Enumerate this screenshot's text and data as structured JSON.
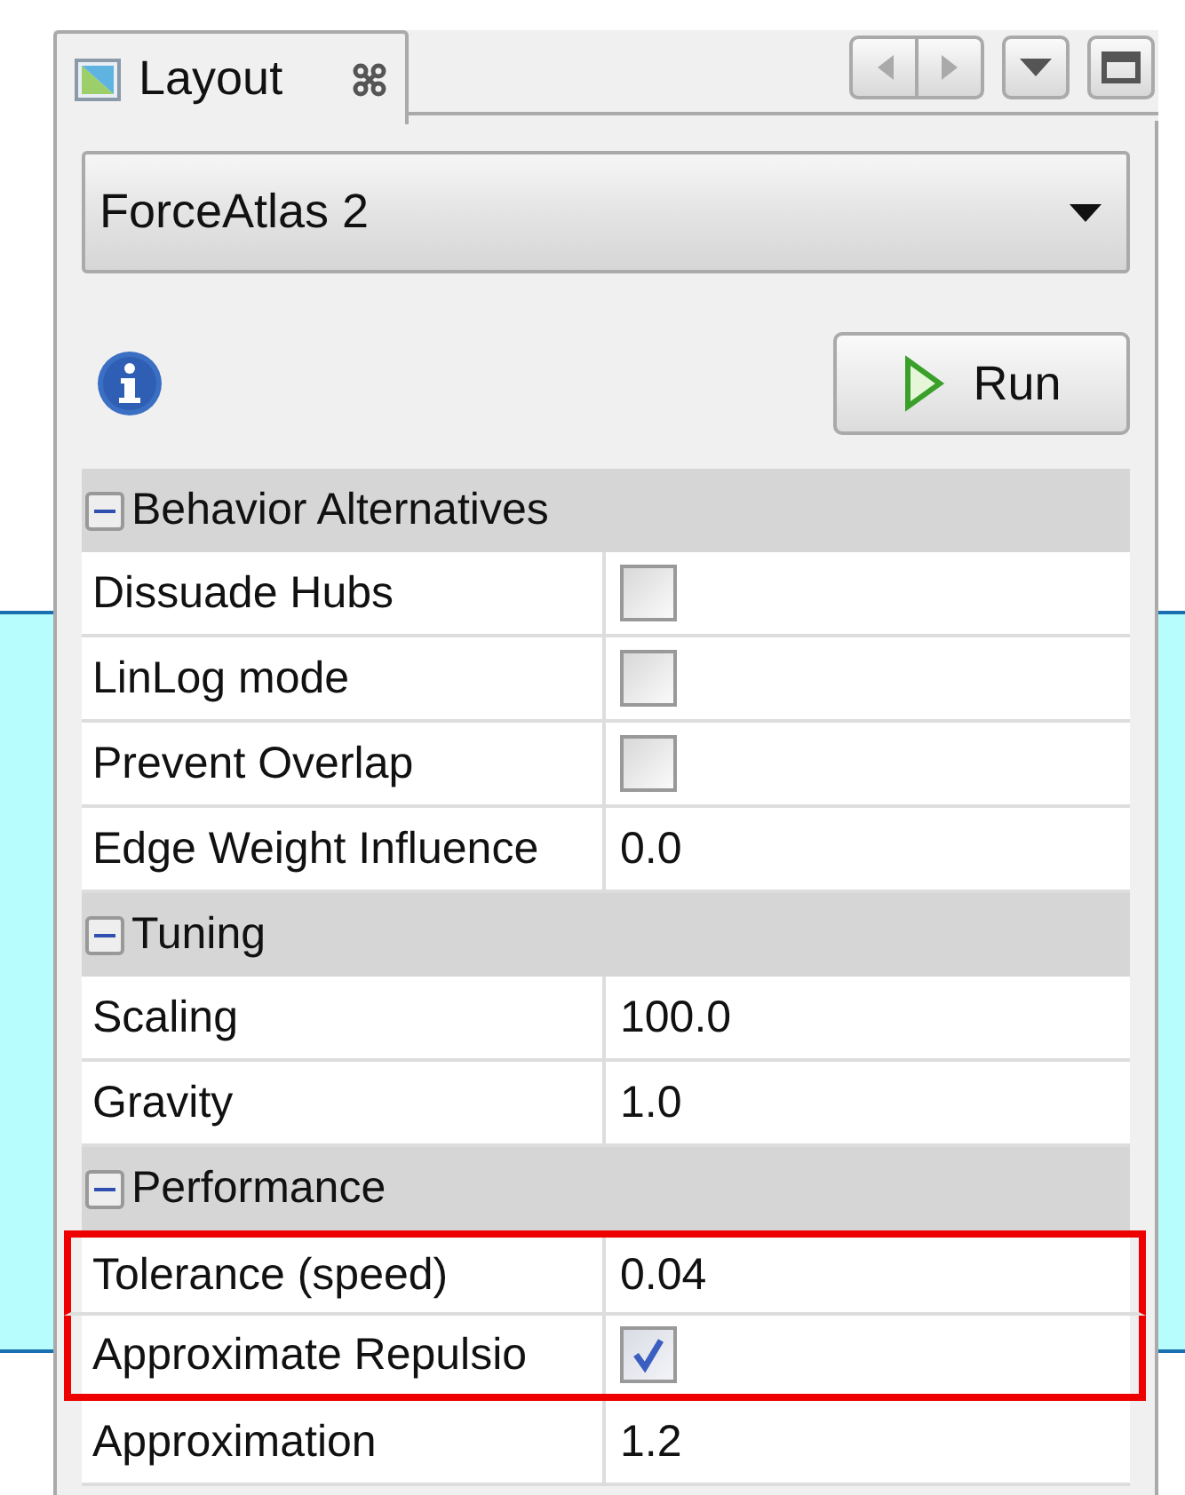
{
  "tab": {
    "label": "Layout",
    "selected": true
  },
  "layout_select": {
    "value": "ForceAtlas 2"
  },
  "run_button": {
    "label": "Run"
  },
  "sections": [
    {
      "title": "Behavior Alternatives",
      "expanded": true,
      "properties": [
        {
          "name": "Dissuade Hubs",
          "kind": "checkbox",
          "checked": false,
          "highlighted": false
        },
        {
          "name": "LinLog mode",
          "kind": "checkbox",
          "checked": false,
          "highlighted": false
        },
        {
          "name": "Prevent Overlap",
          "kind": "checkbox",
          "checked": false,
          "highlighted": false
        },
        {
          "name": "Edge Weight Influence",
          "kind": "value",
          "value": "0.0",
          "highlighted": false
        }
      ]
    },
    {
      "title": "Tuning",
      "expanded": true,
      "properties": [
        {
          "name": "Scaling",
          "kind": "value",
          "value": "100.0",
          "highlighted": false
        },
        {
          "name": "Gravity",
          "kind": "value",
          "value": "1.0",
          "highlighted": false
        }
      ]
    },
    {
      "title": "Performance",
      "expanded": true,
      "properties": [
        {
          "name": "Tolerance (speed)",
          "kind": "value",
          "value": "0.04",
          "highlighted": true
        },
        {
          "name": "Approximate Repulsio",
          "kind": "checkbox",
          "checked": true,
          "highlighted": true
        },
        {
          "name": "Approximation",
          "kind": "value",
          "value": "1.2",
          "highlighted": false
        }
      ]
    }
  ]
}
